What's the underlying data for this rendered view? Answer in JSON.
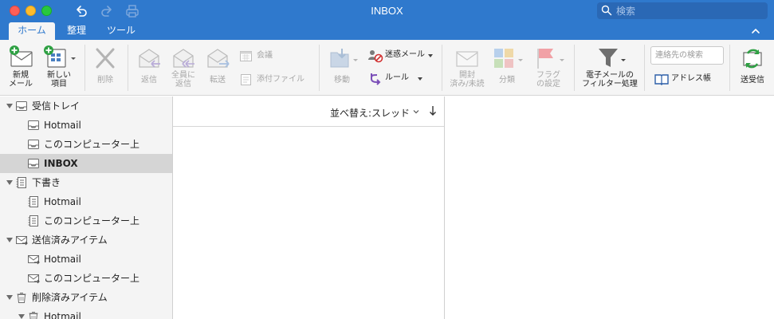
{
  "window": {
    "title": "INBOX"
  },
  "search": {
    "placeholder": "検索"
  },
  "tabs": [
    {
      "label": "ホーム",
      "active": true
    },
    {
      "label": "整理",
      "active": false
    },
    {
      "label": "ツール",
      "active": false
    }
  ],
  "ribbon": {
    "new_mail": "新規\nメール",
    "new_items": "新しい\n項目",
    "delete": "削除",
    "reply": "返信",
    "reply_all": "全員に\n返信",
    "forward": "転送",
    "meeting": "会議",
    "attachment": "添付ファイル",
    "move": "移動",
    "junk": "迷惑メール",
    "rules": "ルール",
    "read_unread": "開封\n済み/未読",
    "categorize": "分類",
    "follow_up": "フラグ\nの設定",
    "filter_email": "電子メールの\nフィルター処理",
    "contact_search_placeholder": "連絡先の検索",
    "address_book": "アドレス帳",
    "send_receive": "送受信"
  },
  "folders": [
    {
      "label": "受信トレイ",
      "level": 0,
      "icon": "inbox-icon",
      "expanded": true,
      "selected": false
    },
    {
      "label": "Hotmail",
      "level": 1,
      "icon": "inbox-icon",
      "selected": false
    },
    {
      "label": "このコンピューター上",
      "level": 1,
      "icon": "inbox-icon",
      "selected": false
    },
    {
      "label": "INBOX",
      "level": 1,
      "icon": "inbox-icon",
      "selected": true
    },
    {
      "label": "下書き",
      "level": 0,
      "icon": "drafts-icon",
      "expanded": true,
      "selected": false
    },
    {
      "label": "Hotmail",
      "level": 1,
      "icon": "drafts-icon",
      "selected": false
    },
    {
      "label": "このコンピューター上",
      "level": 1,
      "icon": "drafts-icon",
      "selected": false
    },
    {
      "label": "送信済みアイテム",
      "level": 0,
      "icon": "sent-icon",
      "expanded": true,
      "selected": false
    },
    {
      "label": "Hotmail",
      "level": 1,
      "icon": "sent-icon",
      "selected": false
    },
    {
      "label": "このコンピューター上",
      "level": 1,
      "icon": "sent-icon",
      "selected": false
    },
    {
      "label": "削除済みアイテム",
      "level": 0,
      "icon": "deleted-icon",
      "expanded": true,
      "selected": false
    },
    {
      "label": "Hotmail",
      "level": 1,
      "icon": "deleted-icon",
      "expanded": true,
      "selected": false
    }
  ],
  "message_list": {
    "sort_label": "並べ替え:スレッド"
  },
  "colors": {
    "accent": "#2f79cd",
    "selected_row": "#d5d5d5"
  }
}
